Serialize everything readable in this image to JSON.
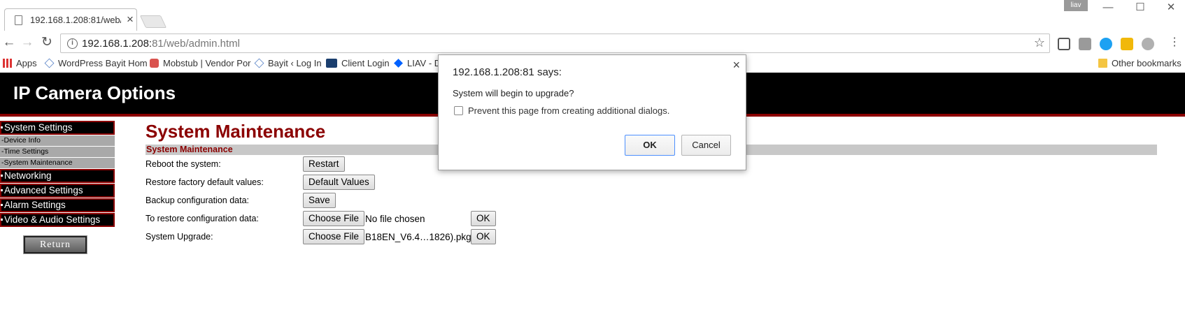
{
  "browser": {
    "tab_title": "192.168.1.208:81/web/ad",
    "tab_close": "×",
    "profile_name": "liav",
    "window_controls": [
      "—",
      "☐",
      "✕"
    ],
    "url_host": "192.168.1.208:",
    "url_rest": "81/web/admin.html",
    "star": "☆",
    "back": "←",
    "forward": "→",
    "reload": "↻",
    "extension_colors": [
      "#555555",
      "#9a9a9a",
      "#1da1f2",
      "#f1b80a",
      "#b0b0b0"
    ]
  },
  "bookmarks": {
    "items": [
      {
        "label": "Apps",
        "icon": "apps-grid-icon",
        "color": "#d33"
      },
      {
        "label": "WordPress Bayit Hom",
        "icon": "home-icon",
        "color": "#4a78c2"
      },
      {
        "label": "Mobstub | Vendor Por",
        "icon": "mobstub-icon",
        "color": "#d9534f"
      },
      {
        "label": "Bayit ‹ Log In",
        "icon": "home-icon",
        "color": "#4a78c2"
      },
      {
        "label": "Client Login",
        "icon": "cit-logo-icon",
        "color": "#1a3e6e"
      },
      {
        "label": "LIAV - D",
        "icon": "dropbox-icon",
        "color": "#0061ff"
      }
    ],
    "other": "Other bookmarks"
  },
  "page": {
    "header_title": "IP Camera Options",
    "menu": [
      {
        "label": "System Settings",
        "type": "main"
      },
      {
        "label": "-Device Info",
        "type": "sub"
      },
      {
        "label": "-Time Settings",
        "type": "sub"
      },
      {
        "label": "-System Maintenance",
        "type": "sub"
      },
      {
        "label": "Networking",
        "type": "main"
      },
      {
        "label": "Advanced Settings",
        "type": "main"
      },
      {
        "label": "Alarm Settings",
        "type": "main"
      },
      {
        "label": "Video & Audio Settings",
        "type": "main"
      }
    ],
    "return_label": "Return",
    "main_title": "System Maintenance",
    "section_title": "System Maintenance",
    "rows": {
      "reboot": {
        "label": "Reboot the system:",
        "button": "Restart"
      },
      "factory": {
        "label": "Restore factory default values:",
        "button": "Default Values"
      },
      "backup": {
        "label": "Backup configuration data:",
        "button": "Save"
      },
      "restore": {
        "label": "To restore configuration data:",
        "button": "Choose File",
        "file": "No file chosen",
        "ok": "OK"
      },
      "upgrade": {
        "label": "System Upgrade:",
        "button": "Choose File",
        "file": "B18EN_V6.4…1826).pkg",
        "ok": "OK"
      }
    }
  },
  "dialog": {
    "title": "192.168.1.208:81 says:",
    "message": "System will begin to upgrade?",
    "checkbox_label": "Prevent this page from creating additional dialogs.",
    "checkbox_checked": false,
    "ok": "OK",
    "cancel": "Cancel",
    "close": "×"
  }
}
